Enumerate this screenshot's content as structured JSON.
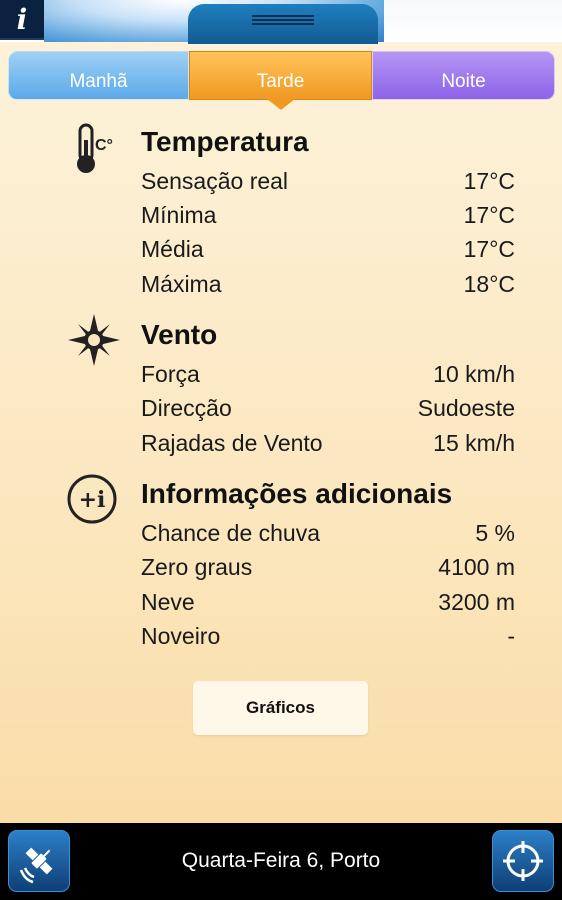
{
  "header": {
    "info_icon": "info-icon",
    "handle_icon": "drag-handle-icon"
  },
  "tabs": [
    {
      "label": "Manhã"
    },
    {
      "label": "Tarde",
      "selected": true
    },
    {
      "label": "Noite"
    }
  ],
  "sections": {
    "temperature": {
      "icon": "thermometer-icon",
      "icon_text": "C°",
      "title": "Temperatura",
      "rows": [
        {
          "label": "Sensação real",
          "value": "17°C"
        },
        {
          "label": "Mínima",
          "value": "17°C"
        },
        {
          "label": "Média",
          "value": "17°C"
        },
        {
          "label": "Máxima",
          "value": "18°C"
        }
      ]
    },
    "wind": {
      "icon": "compass-icon",
      "title": "Vento",
      "rows": [
        {
          "label": "Força",
          "value": "10 km/h"
        },
        {
          "label": "Direcção",
          "value": "Sudoeste"
        },
        {
          "label": "Rajadas de Vento",
          "value": "15 km/h"
        }
      ]
    },
    "additional": {
      "icon": "more-info-icon",
      "icon_text": "+i",
      "title": "Informações adicionais",
      "rows": [
        {
          "label": "Chance de chuva",
          "value": "5 %"
        },
        {
          "label": "Zero graus",
          "value": "4100 m"
        },
        {
          "label": "Neve",
          "value": "3200 m"
        },
        {
          "label": "Noveiro",
          "value": "-"
        }
      ]
    }
  },
  "graphs_button": {
    "label": "Gráficos"
  },
  "footer": {
    "location": "Quarta-Feira 6, Porto",
    "left_icon": "satellite-icon",
    "right_icon": "crosshair-icon"
  },
  "colors": {
    "morning_tab": "#5ba9e8",
    "afternoon_tab": "#f09a23",
    "night_tab": "#8d63e8",
    "background": "#fbe6bd",
    "footer": "#000000"
  }
}
